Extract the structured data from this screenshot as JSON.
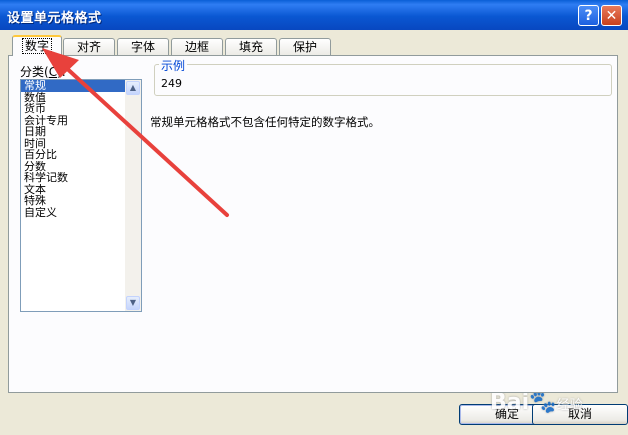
{
  "window": {
    "title": "设置单元格格式",
    "help_glyph": "?",
    "close_glyph": "✕"
  },
  "tabs": [
    {
      "label": "数字",
      "active": true
    },
    {
      "label": "对齐"
    },
    {
      "label": "字体"
    },
    {
      "label": "边框"
    },
    {
      "label": "填充"
    },
    {
      "label": "保护"
    }
  ],
  "category": {
    "label": "分类",
    "mnemonic": "C",
    "items": [
      "常规",
      "数值",
      "货币",
      "会计专用",
      "日期",
      "时间",
      "百分比",
      "分数",
      "科学记数",
      "文本",
      "特殊",
      "自定义"
    ],
    "selected": "常规"
  },
  "sample": {
    "legend": "示例",
    "value": "249"
  },
  "description": "常规单元格格式不包含任何特定的数字格式。",
  "buttons": {
    "ok": "确定",
    "cancel": "取消"
  },
  "watermark": {
    "brand": "Bai",
    "suffix": "经验"
  },
  "colors": {
    "title_bar": "#0a5fd6",
    "selection": "#316ac5",
    "annotation_arrow": "#e8413c"
  }
}
